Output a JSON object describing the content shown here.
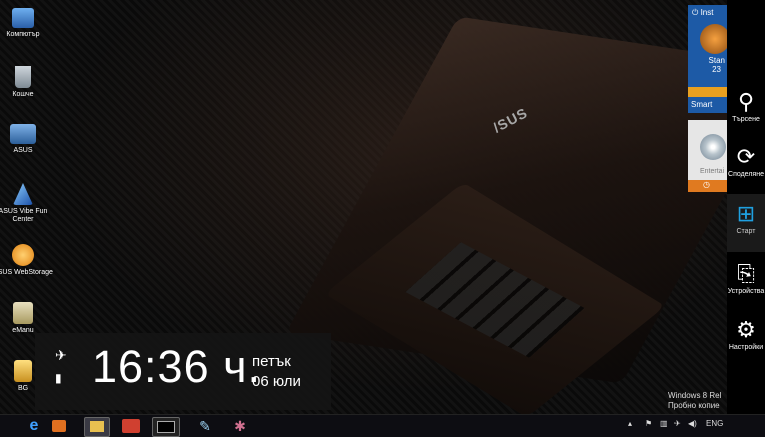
{
  "desktop_icons": [
    {
      "name": "icon-computer",
      "label": "Компютър",
      "color": "#4a90d9"
    },
    {
      "name": "icon-recycle-bin",
      "label": "Кошче",
      "color": "#9aa6b0"
    },
    {
      "name": "icon-asus",
      "label": "ASUS",
      "color": "#3f7ab5"
    },
    {
      "name": "icon-asus-vibe",
      "label": "ASUS Vibe Fun Center",
      "color": "#2a6fd0"
    },
    {
      "name": "icon-asus-webstorage",
      "label": "ASUS WebStorage",
      "color": "#f0a020"
    },
    {
      "name": "icon-emanual",
      "label": "eManu",
      "color": "#d2c89a"
    },
    {
      "name": "icon-bg",
      "label": "BG",
      "color": "#e8c040"
    }
  ],
  "wallpaper_brand": "/SUS",
  "clock": {
    "time": "16:36 ч.",
    "day": "петък",
    "date": "06 юли"
  },
  "tiles": {
    "instant_on": {
      "title": "Inst",
      "line1": "Stan",
      "line2": "23",
      "footer": "Smart",
      "color": "#1d5aa6"
    },
    "entertainment": {
      "title": "Entertai",
      "color": "#e07a20"
    }
  },
  "charms": [
    {
      "label": "Търсене",
      "icon": "search-icon"
    },
    {
      "label": "Споделяне",
      "icon": "share-icon"
    },
    {
      "label": "Старт",
      "icon": "windows-icon"
    },
    {
      "label": "Устройства",
      "icon": "devices-icon"
    },
    {
      "label": "Настройки",
      "icon": "gear-icon"
    }
  ],
  "watermark": {
    "line1": "Windows 8 Rel",
    "line2": "Пробно копие"
  },
  "taskbar": {
    "language": "ENG"
  }
}
